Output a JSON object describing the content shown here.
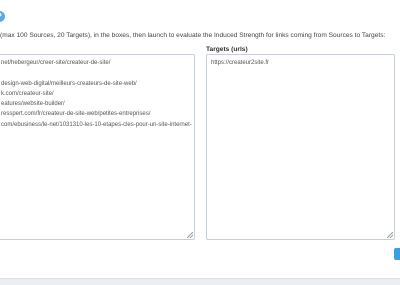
{
  "instructions": "(max 100 Sources, 20 Targets), in the boxes, then launch to evaluate the Induced Strength for links coming from Sources to Targets:",
  "help_icon_glyph": "?",
  "sources": {
    "lines": [
      "net/hebergeur/creer-site/createur-de-site/",
      "",
      "design-web-digital/meilleurs-createurs-de-site-web/",
      "k.com/createur-site/",
      "eatures/website-builder/",
      "resspert.com/fr/createur-de-site-web/petites-entreprises/",
      "com/ebusiness/le-net/1031310-les-10-etapes-cles-pour-un-site-internet-"
    ]
  },
  "targets": {
    "label": "Targets (urls)",
    "lines": [
      "https://createur2site.fr"
    ]
  },
  "colors": {
    "accent": "#3aa0db",
    "border": "#c9ced4",
    "background": "#f3f5f7"
  }
}
